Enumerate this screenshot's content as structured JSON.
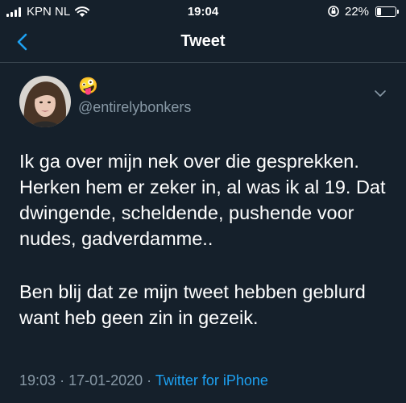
{
  "status_bar": {
    "carrier": "KPN NL",
    "time": "19:04",
    "battery_percent": "22%",
    "battery_level": 0.22,
    "icons": [
      "signal-bars-icon",
      "wifi-icon",
      "orientation-lock-icon",
      "battery-icon"
    ]
  },
  "nav": {
    "title": "Tweet",
    "back_icon": "chevron-left-icon",
    "accent_color": "#1da1f2"
  },
  "author": {
    "emoji": "🤪",
    "handle": "@entirelybonkers"
  },
  "tweet": {
    "paragraphs": [
      "Ik ga over mijn nek over die gesprekken. Herken hem er zeker in, al was ik al 19. Dat dwingende, scheldende, pushende voor nudes, gadverdamme..",
      "Ben blij dat ze mijn tweet hebben geblurd want heb geen zin in gezeik."
    ],
    "time": "19:03",
    "date": "17-01-2020",
    "separator": "·",
    "source": "Twitter for iPhone"
  },
  "colors": {
    "background": "#15202b",
    "text": "#ffffff",
    "muted": "#8899a6",
    "link": "#1da1f2"
  }
}
